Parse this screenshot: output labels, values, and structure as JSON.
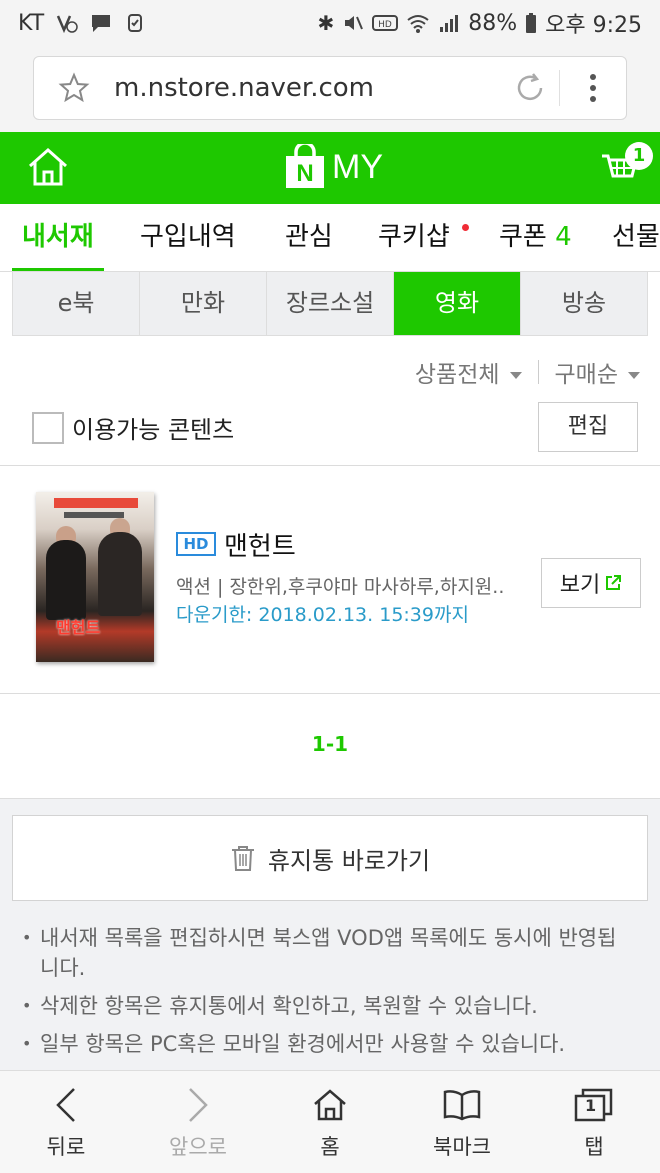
{
  "status": {
    "carrier": "KT",
    "battery": "88%",
    "time": "오후 9:25"
  },
  "browser": {
    "url": "m.nstore.naver.com"
  },
  "header": {
    "title": "MY",
    "logo_letter": "N",
    "cart_count": "1"
  },
  "tabs": [
    {
      "label": "내서재"
    },
    {
      "label": "구입내역"
    },
    {
      "label": "관심"
    },
    {
      "label": "쿠키샵"
    },
    {
      "label": "쿠폰",
      "count": "4"
    },
    {
      "label": "선물"
    }
  ],
  "subtabs": [
    {
      "label": "e북"
    },
    {
      "label": "만화"
    },
    {
      "label": "장르소설"
    },
    {
      "label": "영화"
    },
    {
      "label": "방송"
    }
  ],
  "sort": {
    "filter": "상품전체",
    "order": "구매순"
  },
  "filter": {
    "available_label": "이용가능 콘텐츠",
    "edit_label": "편집"
  },
  "item": {
    "badge": "HD",
    "title": "맨헌트",
    "meta": "액션 | 장한위,후쿠야마 마사하루,하지원..",
    "expire": "다운기한: 2018.02.13. 15:39까지",
    "view_label": "보기",
    "poster_title": "맨헌트"
  },
  "pager": "1-1",
  "trash": {
    "label": "휴지통 바로가기"
  },
  "notes": [
    "내서재 목록을 편집하시면 북스앱 VOD앱 목록에도 동시에 반영됩니다.",
    "삭제한 항목은 휴지통에서 확인하고, 복원할 수 있습니다.",
    "일부 항목은 PC혹은 모바일 환경에서만 사용할 수 있습니다."
  ],
  "bottom_nav": {
    "back": "뒤로",
    "forward": "앞으로",
    "home": "홈",
    "bookmark": "북마크",
    "tabs": "탭",
    "tab_count": "1"
  },
  "colors": {
    "brand": "#1ec800",
    "link": "#2a9bc9",
    "hd": "#2a8bdc",
    "dot": "#f02c36"
  }
}
